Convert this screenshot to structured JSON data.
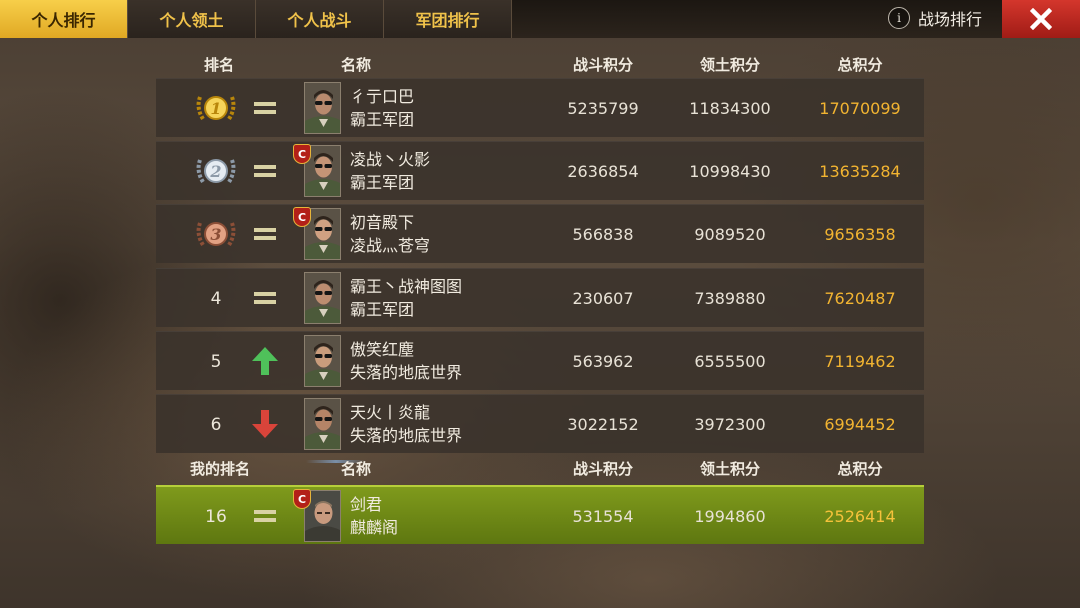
{
  "tabs": [
    {
      "label": "个人排行",
      "active": true
    },
    {
      "label": "个人领土",
      "active": false
    },
    {
      "label": "个人战斗",
      "active": false
    },
    {
      "label": "军团排行",
      "active": false
    }
  ],
  "battle_rank": {
    "label": "战场排行",
    "info_icon": "i"
  },
  "header": {
    "rank": "排名",
    "name": "名称",
    "battle": "战斗积分",
    "territory": "领土积分",
    "total": "总积分"
  },
  "rows": [
    {
      "rank": "1",
      "medal": "gold",
      "change": "same",
      "commander": false,
      "player": "彳亍口巴",
      "legion": "霸王军团",
      "battle": "5235799",
      "territory": "11834300",
      "total": "17070099"
    },
    {
      "rank": "2",
      "medal": "silver",
      "change": "same",
      "commander": true,
      "player": "凌战丶火影",
      "legion": "霸王军团",
      "battle": "2636854",
      "territory": "10998430",
      "total": "13635284"
    },
    {
      "rank": "3",
      "medal": "bronze",
      "change": "same",
      "commander": true,
      "player": "初音殿下",
      "legion": "凌战灬苍穹",
      "battle": "566838",
      "territory": "9089520",
      "total": "9656358"
    },
    {
      "rank": "4",
      "medal": "",
      "change": "same",
      "commander": false,
      "player": "霸王丶战神图图",
      "legion": "霸王军团",
      "battle": "230607",
      "territory": "7389880",
      "total": "7620487"
    },
    {
      "rank": "5",
      "medal": "",
      "change": "up",
      "commander": false,
      "player": "傲笑红塵",
      "legion": "失落的地底世界",
      "battle": "563962",
      "territory": "6555500",
      "total": "7119462"
    },
    {
      "rank": "6",
      "medal": "",
      "change": "down",
      "commander": false,
      "player": "天火丨炎龍",
      "legion": "失落的地底世界",
      "battle": "3022152",
      "territory": "3972300",
      "total": "6994452"
    }
  ],
  "my_header": {
    "rank": "我的排名",
    "name": "名称",
    "battle": "战斗积分",
    "territory": "领土积分",
    "total": "总积分"
  },
  "my_row": {
    "rank": "16",
    "change": "same",
    "commander": true,
    "player": "剑君",
    "legion": "麒麟阁",
    "battle": "531554",
    "territory": "1994860",
    "total": "2526414"
  },
  "commander_badge": "C",
  "colors": {
    "tab_active": "#f0bc35",
    "tab_text": "#f0c24a",
    "total_score": "#f2b431",
    "my_row": "#6f8a18",
    "close": "#c02a22",
    "arrow_up": "#4fc15a",
    "arrow_down": "#d9443a"
  }
}
